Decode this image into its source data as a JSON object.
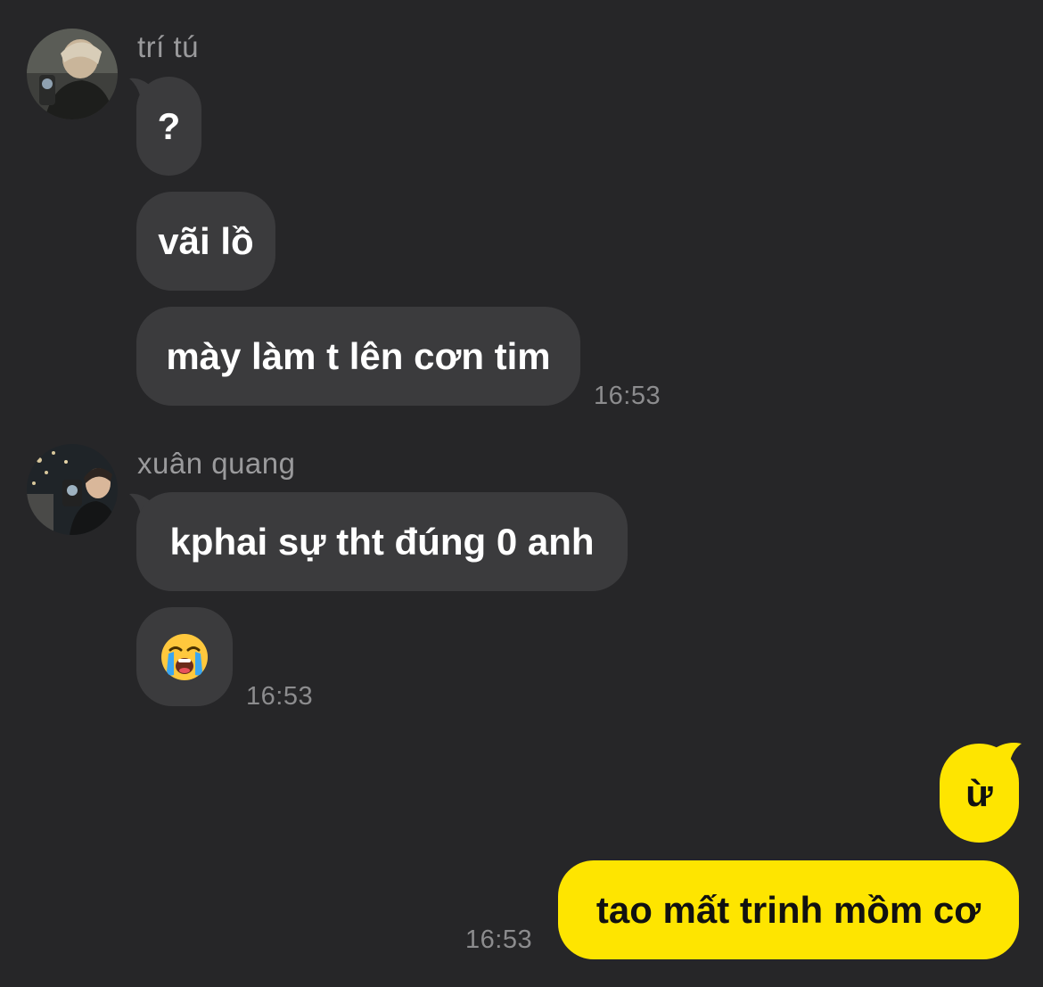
{
  "groups": [
    {
      "sender": "trí tú",
      "avatar_icon": "profile-photo",
      "messages": [
        "?",
        "vãi lồ",
        "mày làm t lên cơn tim"
      ],
      "time": "16:53"
    },
    {
      "sender": "xuân quang",
      "avatar_icon": "profile-photo",
      "messages": [
        "kphai sự tht đúng 0 anh",
        "loudly-crying-face-emoji"
      ],
      "time": "16:53"
    }
  ],
  "mine": {
    "messages": [
      "ừ",
      "tao mất trinh mồm cơ"
    ],
    "time": "16:53"
  },
  "colors": {
    "background": "#262628",
    "incoming_bubble": "#3b3b3d",
    "outgoing_bubble": "#fee500",
    "meta_text": "#9a9a9c"
  }
}
